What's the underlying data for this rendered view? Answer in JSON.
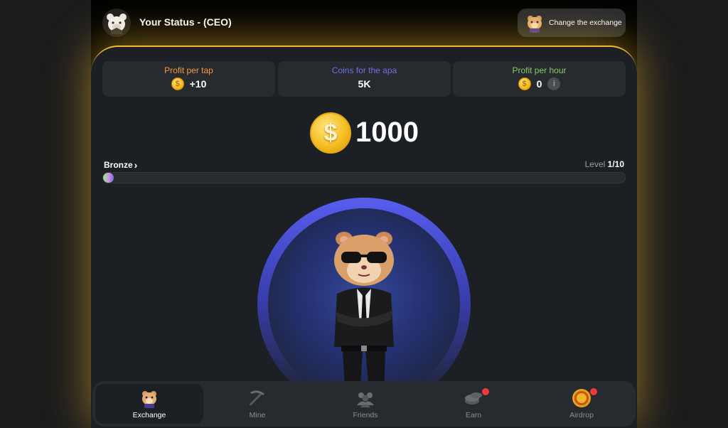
{
  "header": {
    "title": "Your Status - (CEO)",
    "avatar_icon": "hamster-avatar-icon",
    "exchange_button_label": "Change the exchange",
    "exchange_icon": "hamster-icon"
  },
  "stats": [
    {
      "label": "Profit per tap",
      "value": "+10",
      "color": "#f79841",
      "icon": "coin-icon"
    },
    {
      "label": "Coins for the apa",
      "value": "5K",
      "color": "#6f72e2",
      "icon": ""
    },
    {
      "label": "Profit per hour",
      "value": "0",
      "color": "#84cb69",
      "icon": "coin-icon",
      "info_icon": "info-icon"
    }
  ],
  "balance": {
    "value": "1000",
    "coin_symbol": "$"
  },
  "league": {
    "name": "Bronze",
    "chevron": "›"
  },
  "level": {
    "label": "Level",
    "value": "1/10"
  },
  "progress": {
    "fraction": 0.02
  },
  "coin_glyph": "$",
  "info_glyph": "i",
  "nav": {
    "items": [
      {
        "label": "Exchange",
        "icon": "hamster-icon",
        "active": true,
        "badge": false
      },
      {
        "label": "Mine",
        "icon": "pickaxe-icon",
        "active": false,
        "badge": false
      },
      {
        "label": "Friends",
        "icon": "friends-icon",
        "active": false,
        "badge": false
      },
      {
        "label": "Earn",
        "icon": "coins-icon",
        "active": false,
        "badge": true
      },
      {
        "label": "Airdrop",
        "icon": "airdrop-coin-icon",
        "active": false,
        "badge": true
      }
    ]
  },
  "colors": {
    "accent": "#f3ba2f",
    "panel": "#1c1f24",
    "card": "#272a2f",
    "badge": "#ef3b3b"
  }
}
